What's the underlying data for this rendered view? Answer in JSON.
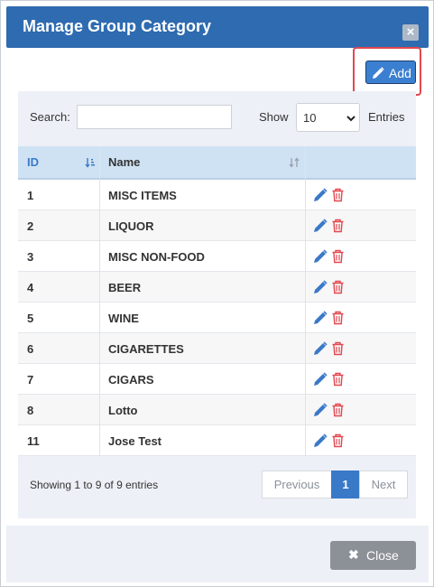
{
  "modal": {
    "title": "Manage Group Category",
    "close_icon": "times-icon",
    "header_color": "#2e6bb0"
  },
  "toolbar": {
    "add_label": "Add",
    "add_icon": "pencil-icon",
    "highlight_color": "#e2474f"
  },
  "table": {
    "search_label": "Search:",
    "search_value": "",
    "show_label": "Show",
    "page_size": "10",
    "entries_label": "Entries",
    "columns": [
      "ID",
      "Name"
    ],
    "rows": [
      {
        "id": "1",
        "name": "MISC ITEMS"
      },
      {
        "id": "2",
        "name": "LIQUOR"
      },
      {
        "id": "3",
        "name": "MISC NON-FOOD"
      },
      {
        "id": "4",
        "name": "BEER"
      },
      {
        "id": "5",
        "name": "WINE"
      },
      {
        "id": "6",
        "name": "CIGARETTES"
      },
      {
        "id": "7",
        "name": "CIGARS"
      },
      {
        "id": "8",
        "name": "Lotto"
      },
      {
        "id": "11",
        "name": "Jose Test"
      }
    ],
    "row_actions": [
      "pencil-icon",
      "trash-icon"
    ],
    "info": "Showing 1 to 9 of 9 entries",
    "pagination": {
      "previous": "Previous",
      "current": "1",
      "next": "Next"
    }
  },
  "footer": {
    "close_label": "Close",
    "close_icon": "times-icon"
  },
  "colors": {
    "accent": "#3a79c8",
    "edit_icon": "#3a79c8",
    "delete_icon": "#e2474f"
  }
}
